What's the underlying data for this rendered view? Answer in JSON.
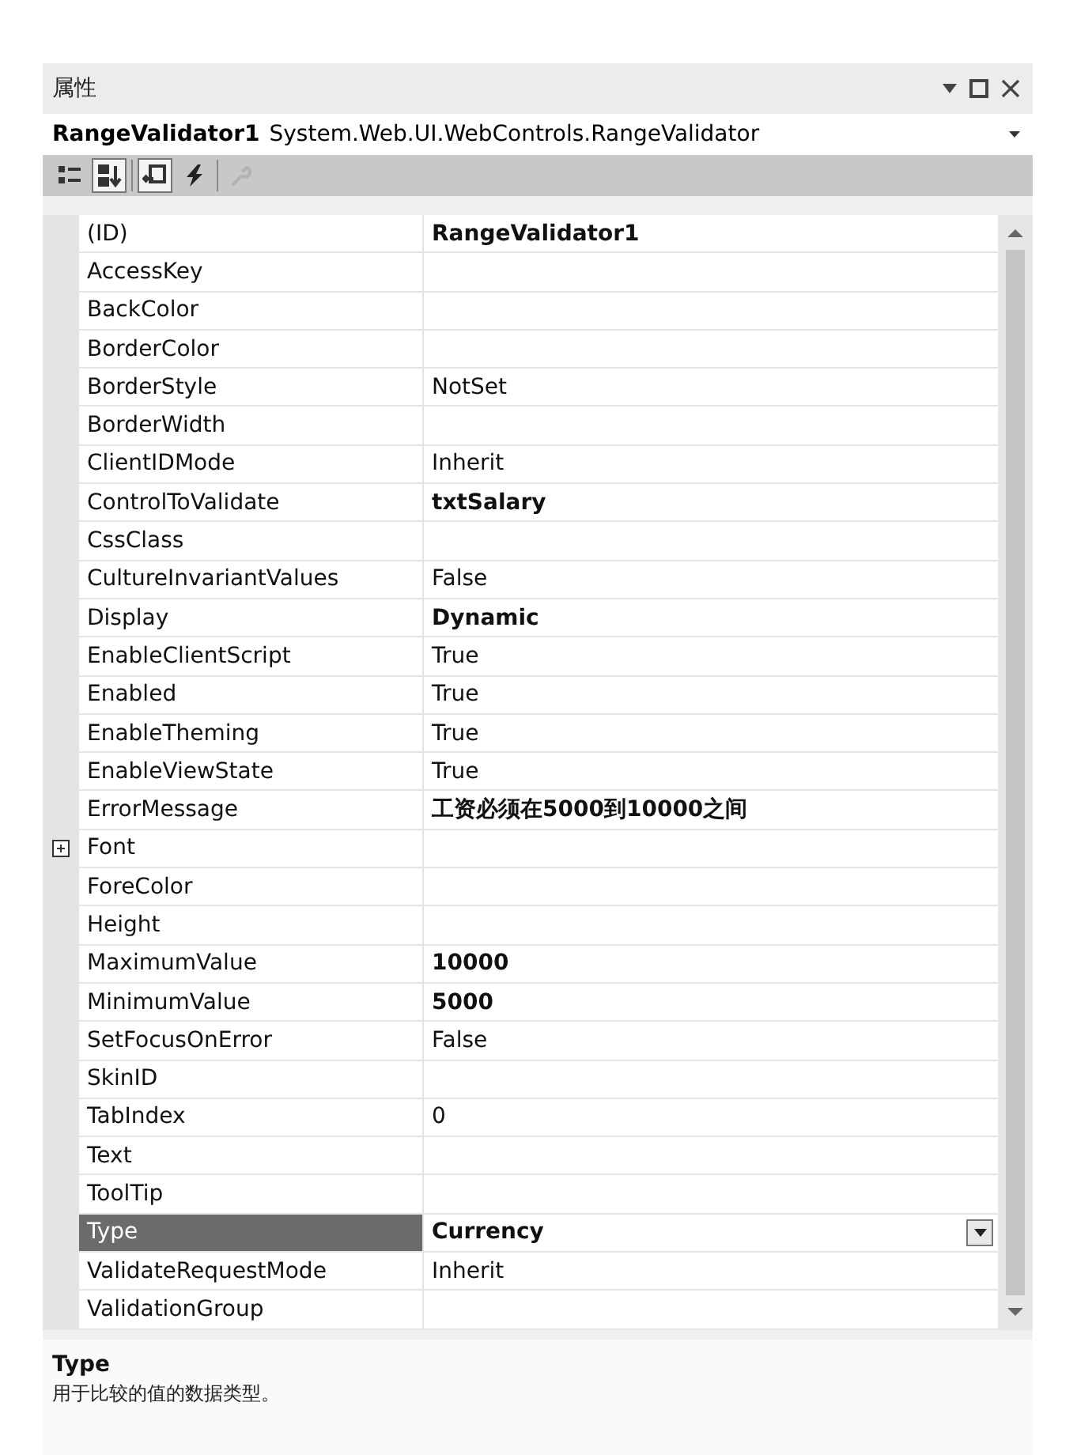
{
  "window": {
    "title": "属性"
  },
  "object_selector": {
    "name": "RangeValidator1",
    "type": "System.Web.UI.WebControls.RangeValidator"
  },
  "toolbar": [
    {
      "kind": "categorized",
      "selected": false,
      "disabled": false
    },
    {
      "kind": "alphabetical",
      "selected": true,
      "disabled": false
    },
    {
      "kind": "separator"
    },
    {
      "kind": "properties",
      "selected": true,
      "disabled": false
    },
    {
      "kind": "events",
      "selected": false,
      "disabled": false
    },
    {
      "kind": "separator"
    },
    {
      "kind": "pages",
      "selected": false,
      "disabled": true
    }
  ],
  "properties": [
    {
      "name": "(ID)",
      "value": "RangeValidator1",
      "modified": true,
      "selected": false
    },
    {
      "name": "AccessKey",
      "modified": false,
      "selected": false
    },
    {
      "name": "BackColor",
      "modified": false,
      "selected": false
    },
    {
      "name": "BorderColor",
      "modified": false,
      "selected": false
    },
    {
      "name": "BorderStyle",
      "value": "NotSet",
      "modified": false,
      "selected": false
    },
    {
      "name": "BorderWidth",
      "modified": false,
      "selected": false
    },
    {
      "name": "ClientIDMode",
      "value": "Inherit",
      "modified": false,
      "selected": false
    },
    {
      "name": "ControlToValidate",
      "value": "txtSalary",
      "modified": true,
      "selected": false
    },
    {
      "name": "CssClass",
      "modified": false,
      "selected": false
    },
    {
      "name": "CultureInvariantValues",
      "value": "False",
      "modified": false,
      "selected": false
    },
    {
      "name": "Display",
      "value": "Dynamic",
      "modified": true,
      "selected": false
    },
    {
      "name": "EnableClientScript",
      "value": "True",
      "modified": false,
      "selected": false
    },
    {
      "name": "Enabled",
      "value": "True",
      "modified": false,
      "selected": false
    },
    {
      "name": "EnableTheming",
      "value": "True",
      "modified": false,
      "selected": false
    },
    {
      "name": "EnableViewState",
      "value": "True",
      "modified": false,
      "selected": false
    },
    {
      "name": "ErrorMessage",
      "value": "工资必须在5000到10000之间",
      "modified": true,
      "selected": false
    },
    {
      "name": "Font",
      "modified": false,
      "selected": false,
      "expanded": false
    },
    {
      "name": "ForeColor",
      "modified": false,
      "selected": false
    },
    {
      "name": "Height",
      "modified": false,
      "selected": false
    },
    {
      "name": "MaximumValue",
      "value": "10000",
      "modified": true,
      "selected": false
    },
    {
      "name": "MinimumValue",
      "value": "5000",
      "modified": true,
      "selected": false
    },
    {
      "name": "SetFocusOnError",
      "value": "False",
      "modified": false,
      "selected": false
    },
    {
      "name": "SkinID",
      "modified": false,
      "selected": false
    },
    {
      "name": "TabIndex",
      "value": "0",
      "modified": false,
      "selected": false
    },
    {
      "name": "Text",
      "modified": false,
      "selected": false
    },
    {
      "name": "ToolTip",
      "modified": false,
      "selected": false
    },
    {
      "name": "Type",
      "value": "Currency",
      "modified": true,
      "selected": true
    },
    {
      "name": "ValidateRequestMode",
      "value": "Inherit",
      "modified": false,
      "selected": false
    },
    {
      "name": "ValidationGroup",
      "modified": false,
      "selected": false
    }
  ],
  "description": {
    "title": "Type",
    "text": "用于比较的值的数据类型。"
  }
}
